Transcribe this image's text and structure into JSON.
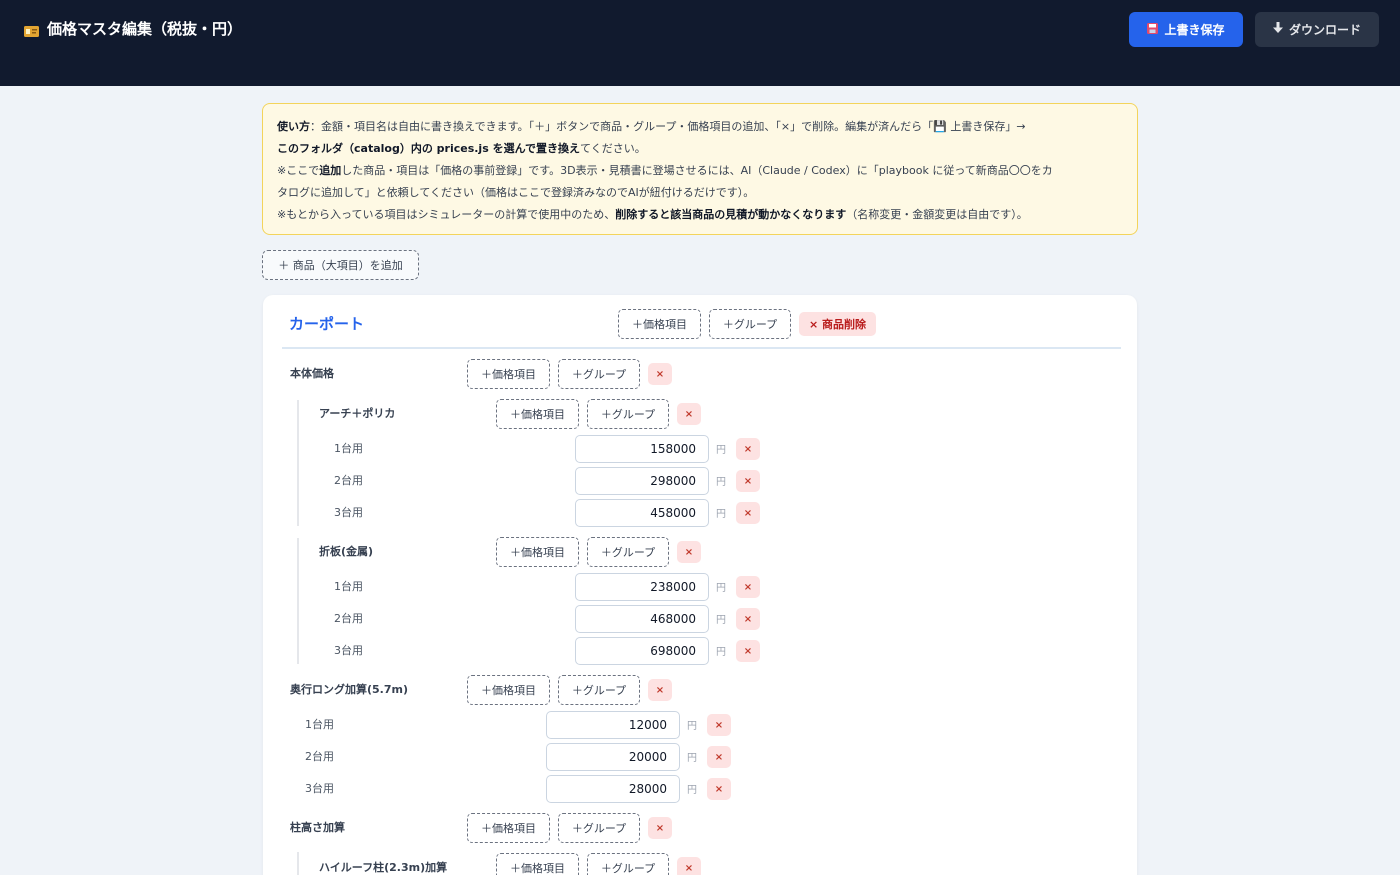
{
  "header": {
    "title": "価格マスタ編集（税抜・円）",
    "save_label": "上書き保存",
    "download_label": "ダウンロード"
  },
  "notice": {
    "l1_b": "使い方",
    "l1_text": "：金額・項目名は自由に書き換えできます。「＋」ボタンで商品・グループ・価格項目の追加、「×」で削除。編集が済んだら「💾 上書き保存」→",
    "l2_b": "このフォルダ（catalog）内の prices.js を選んで置き換え",
    "l2_text": "てください。",
    "l3_a": "※ここで",
    "l3_b": "追加",
    "l3_c": "した商品・項目は「価格の事前登録」です。3D表示・見積書に登場させるには、AI（Claude / Codex）に「playbook に従って新商品〇〇をカ",
    "l4_text": "タログに追加して」と依頼してください（価格はここで登録済みなのでAIが紐付けるだけです）。",
    "l5_a": "※もとから入っている項目はシミュレーターの計算で使用中のため、",
    "l5_b": "削除すると該当商品の見積が動かなくなります",
    "l5_c": "（名称変更・金額変更は自由です）。"
  },
  "labels": {
    "add_product": "＋ 商品（大項目）を追加",
    "add_price_item": "＋価格項目",
    "add_group": "＋グループ",
    "delete_product": "× 商品削除",
    "delete_x": "×",
    "yen": "円"
  },
  "product": {
    "name": "カーポート",
    "groups": [
      {
        "name": "本体価格",
        "subgroups": [
          {
            "name": "アーチ＋ポリカ",
            "items": [
              {
                "label": "1台用",
                "value": "158000"
              },
              {
                "label": "2台用",
                "value": "298000"
              },
              {
                "label": "3台用",
                "value": "458000"
              }
            ]
          },
          {
            "name": "折板(金属)",
            "items": [
              {
                "label": "1台用",
                "value": "238000"
              },
              {
                "label": "2台用",
                "value": "468000"
              },
              {
                "label": "3台用",
                "value": "698000"
              }
            ]
          }
        ]
      },
      {
        "name": "奥行ロング加算(5.7m)",
        "items": [
          {
            "label": "1台用",
            "value": "12000"
          },
          {
            "label": "2台用",
            "value": "20000"
          },
          {
            "label": "3台用",
            "value": "28000"
          }
        ]
      },
      {
        "name": "柱高さ加算",
        "subgroups": [
          {
            "name": "ハイルーフ柱(2.3m)加算"
          }
        ]
      }
    ]
  }
}
